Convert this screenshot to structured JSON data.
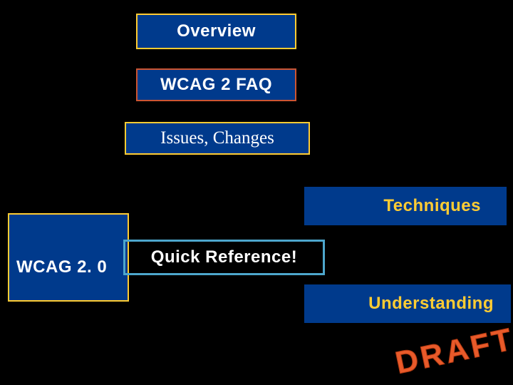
{
  "overview": {
    "label": "Overview"
  },
  "faq": {
    "label": "WCAG 2 FAQ"
  },
  "issues": {
    "label": "Issues, Changes"
  },
  "wcag20": {
    "label": "WCAG 2. 0"
  },
  "techniques": {
    "label": "Techniques"
  },
  "quickref": {
    "label": "Quick Reference!"
  },
  "understanding": {
    "label": "Understanding"
  },
  "watermark": {
    "label": "DRAFT"
  }
}
